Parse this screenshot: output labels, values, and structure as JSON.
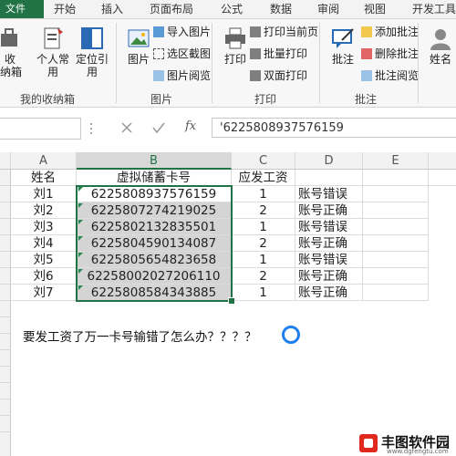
{
  "ribbon_tabs": [
    {
      "label": "文件"
    },
    {
      "label": "开始"
    },
    {
      "label": "插入"
    },
    {
      "label": "页面布局"
    },
    {
      "label": "公式"
    },
    {
      "label": "数据"
    },
    {
      "label": "审阅"
    },
    {
      "label": "视图"
    },
    {
      "label": "开发工具"
    }
  ],
  "ribbon": {
    "group_mine": {
      "label": "我的收纳箱",
      "btn_shou": "收\n纳箱",
      "btn_personal": "个人常\n用",
      "btn_locate": "定位引\n用"
    },
    "group_image": {
      "label": "图片",
      "btn_image": "图片",
      "import_image": "导入图片",
      "select_crop": "选区截图",
      "image_browse": "图片阅览"
    },
    "group_print": {
      "label": "打印",
      "btn_print": "打印",
      "print_current": "打印当前页",
      "batch_print": "批量打印",
      "duplex_print": "双面打印"
    },
    "group_comment": {
      "label": "批注",
      "btn_comment": "批注",
      "add_comment": "添加批注",
      "delete_comment": "删除批注",
      "comment_browse": "批注阅览"
    },
    "btn_name": "姓名"
  },
  "formula_bar": {
    "fx": "fx",
    "value": "'6225808937576159"
  },
  "sheet": {
    "columns": [
      "A",
      "B",
      "C",
      "D",
      "E"
    ],
    "selected_column": "B",
    "headers": {
      "name": "姓名",
      "card": "虚拟储蓄卡号",
      "pay": "应发工资"
    },
    "rows": [
      {
        "name": "刘1",
        "card": "6225808937576159",
        "pay": "1",
        "status": "账号错误"
      },
      {
        "name": "刘2",
        "card": "6225807274219025",
        "pay": "2",
        "status": "账号正确"
      },
      {
        "name": "刘3",
        "card": "6225802132835501",
        "pay": "1",
        "status": "账号错误"
      },
      {
        "name": "刘4",
        "card": "6225804590134087",
        "pay": "2",
        "status": "账号正确"
      },
      {
        "name": "刘5",
        "card": "6225805654823658",
        "pay": "1",
        "status": "账号错误"
      },
      {
        "name": "刘6",
        "card": "62258002027206110",
        "pay": "2",
        "status": "账号正确"
      },
      {
        "name": "刘7",
        "card": "6225808584343885",
        "pay": "1",
        "status": "账号正确"
      }
    ],
    "question": "要发工资了万一卡号输错了怎么办？？？？"
  },
  "watermark": {
    "name": "丰图软件园",
    "url": "www.dgfengtu.com"
  },
  "colors": {
    "accent": "#217346",
    "selection_fill": "#d4d4d4",
    "spinner": "#1e7ff0",
    "logo_red": "#e0281d"
  }
}
